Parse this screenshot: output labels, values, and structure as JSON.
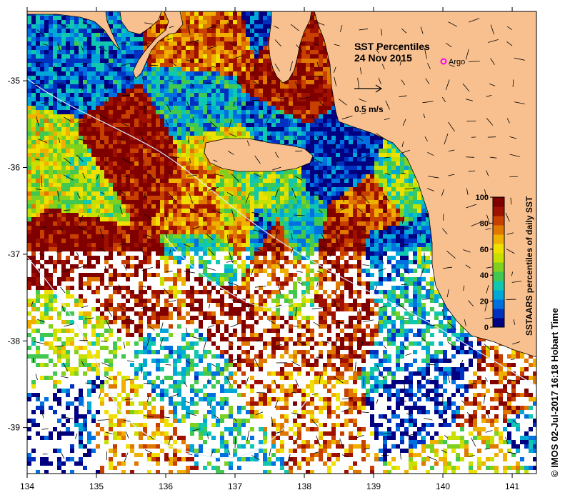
{
  "title": "SST Percentiles",
  "date": "24 Nov 2015",
  "argo_label": "Argo",
  "scale_label": "0.5 m/s",
  "credit": "© IMOS 02-Jul-2017 16:18 Hobart Time",
  "colorbar": {
    "label": "SSTAARS percentiles of daily SST",
    "ticks": [
      "0",
      "20",
      "40",
      "60",
      "80",
      "100"
    ],
    "tick_values": [
      0,
      20,
      40,
      60,
      80,
      100
    ],
    "colors": [
      "#000080",
      "#0030c0",
      "#0070e0",
      "#00a8d8",
      "#10c8b0",
      "#40c850",
      "#80d020",
      "#c8e000",
      "#f0e000",
      "#f0b000",
      "#e07800",
      "#c84000",
      "#a01000",
      "#800000"
    ]
  },
  "axes": {
    "x_ticks": [
      "134",
      "135",
      "136",
      "137",
      "138",
      "139",
      "140",
      "141"
    ],
    "x_values": [
      134,
      135,
      136,
      137,
      138,
      139,
      140,
      141
    ],
    "y_ticks": [
      "-35",
      "-36",
      "-37",
      "-38",
      "-39"
    ],
    "y_values": [
      -35,
      -36,
      -37,
      -38,
      -39
    ],
    "xlim": [
      134,
      141.35
    ],
    "ylim": [
      -39.53,
      -34.2
    ]
  },
  "colors": {
    "land": "#f9c08f",
    "missing_data": "#ffffff",
    "argo_marker": "#ff00ff",
    "contour": "#d8ecff",
    "arrows": "#000000"
  }
}
